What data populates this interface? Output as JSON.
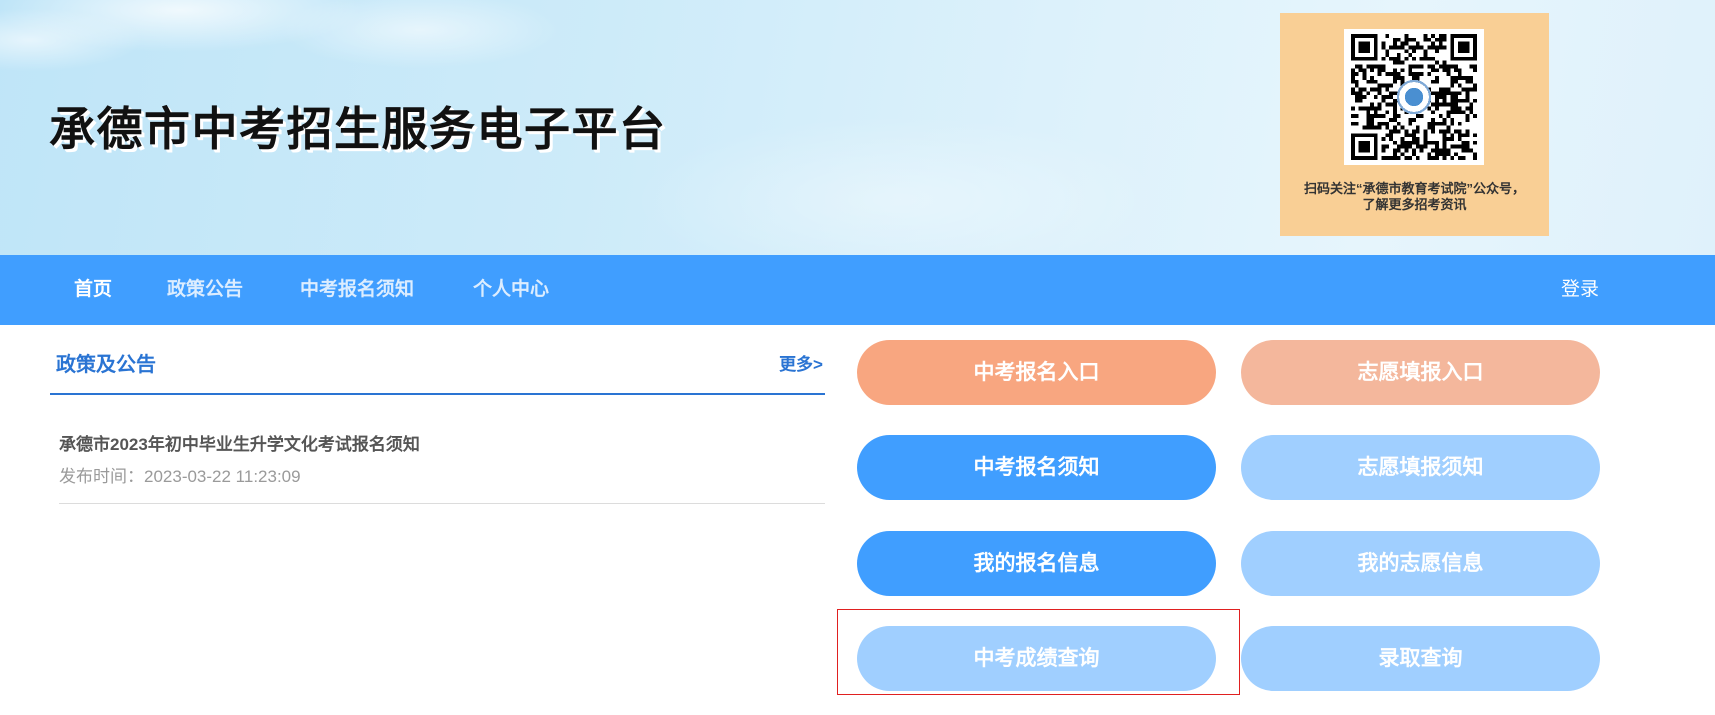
{
  "header": {
    "title": "承德市中考招生服务电子平台",
    "qr": {
      "icon": "qr-code",
      "caption_line1": "扫码关注“承德市教育考试院”公众号，",
      "caption_line2": "了解更多招考资讯"
    }
  },
  "nav": {
    "items": [
      {
        "label": "首页",
        "active": true
      },
      {
        "label": "政策公告",
        "active": false
      },
      {
        "label": "中考报名须知",
        "active": false
      },
      {
        "label": "个人中心",
        "active": false
      }
    ],
    "login_label": "登录"
  },
  "policy": {
    "title": "政策及公告",
    "more_label": "更多>",
    "articles": [
      {
        "title": "承德市2023年初中毕业生升学文化考试报名须知",
        "published": "发布时间：2023-03-22 11:23:09"
      }
    ]
  },
  "actions": [
    {
      "label": "中考报名入口",
      "color": "#f8a680"
    },
    {
      "label": "志愿填报入口",
      "color": "#f4b79c"
    },
    {
      "label": "中考报名须知",
      "color": "#409eff"
    },
    {
      "label": "志愿填报须知",
      "color": "#a0cfff"
    },
    {
      "label": "我的报名信息",
      "color": "#409eff"
    },
    {
      "label": "我的志愿信息",
      "color": "#a0cfff"
    },
    {
      "label": "中考成绩查询",
      "color": "#a0cfff"
    },
    {
      "label": "录取查询",
      "color": "#a0cfff"
    }
  ],
  "colors": {
    "nav_bg": "#409eff",
    "qr_box_bg": "#f9cf95",
    "policy_accent": "#2a74d3",
    "highlight": "#e02020"
  }
}
